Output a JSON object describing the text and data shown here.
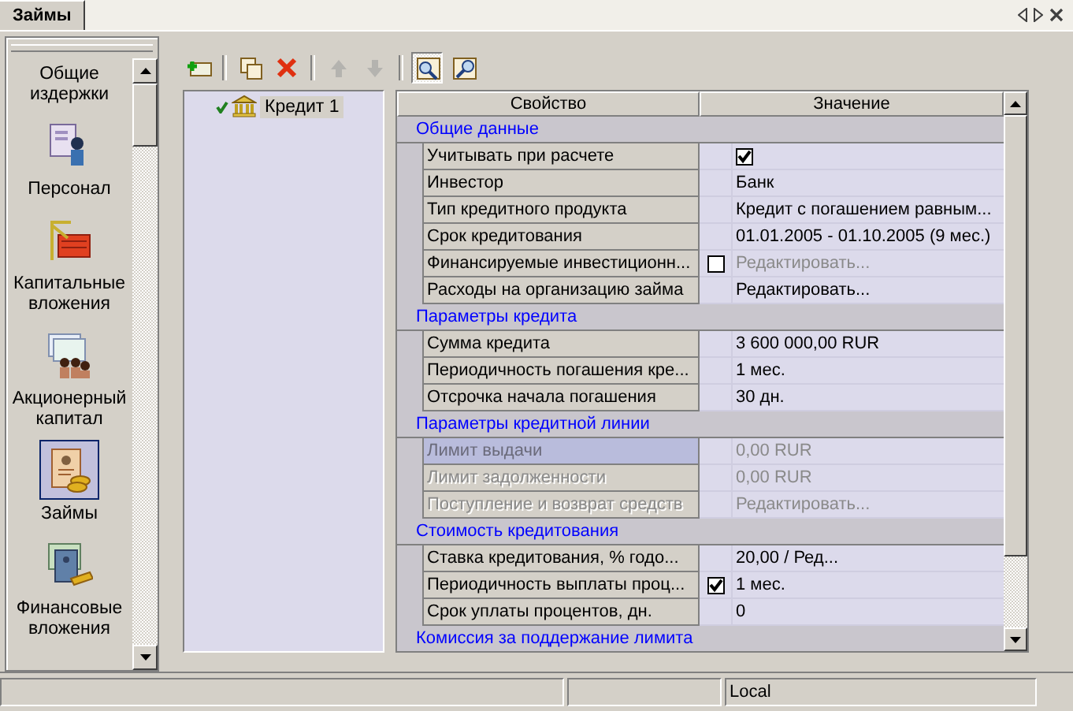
{
  "tabs": [
    {
      "label": "Займы",
      "selected": true
    }
  ],
  "sidebar": {
    "items": [
      {
        "label": "Общие издержки",
        "selected": false
      },
      {
        "label": "Персонал",
        "kind": "staff",
        "selected": false
      },
      {
        "label": "Капитальные вложения",
        "kind": "construction",
        "selected": false
      },
      {
        "label": "Акционерный капитал",
        "kind": "shareholders",
        "selected": false
      },
      {
        "label": "Займы",
        "kind": "loans",
        "selected": true
      },
      {
        "label": "Финансовые вложения",
        "kind": "investments",
        "selected": false
      }
    ]
  },
  "toolbar": {
    "buttons": [
      {
        "kind": "add",
        "disabled": false,
        "pressed": false
      },
      {
        "kind": "copy",
        "disabled": false,
        "pressed": false
      },
      {
        "kind": "delete",
        "disabled": false,
        "pressed": false
      },
      {
        "kind": "up",
        "disabled": true,
        "pressed": false
      },
      {
        "kind": "down",
        "disabled": true,
        "pressed": false
      },
      {
        "kind": "view",
        "disabled": false,
        "pressed": true
      },
      {
        "kind": "find",
        "disabled": false,
        "pressed": false
      }
    ]
  },
  "tree": {
    "items": [
      {
        "label": "Кредит 1",
        "checked": true,
        "selected": true
      }
    ]
  },
  "grid": {
    "columns": [
      "Свойство",
      "Значение"
    ],
    "groups": [
      {
        "title": "Общие данные",
        "rows": [
          {
            "kind": "check",
            "name": "Учитывать при расчете",
            "checked": true,
            "disabled": false,
            "selected": false
          },
          {
            "kind": "text",
            "name": "Инвестор",
            "value": "Банк",
            "disabled": false,
            "selected": false
          },
          {
            "kind": "text",
            "name": "Тип кредитного продукта",
            "value": "Кредит с погашением равным...",
            "disabled": false,
            "selected": false
          },
          {
            "kind": "text",
            "name": "Срок кредитования",
            "value": "01.01.2005 - 01.10.2005 (9 мес.)",
            "disabled": false,
            "selected": false
          },
          {
            "kind": "toggle",
            "name": "Финансируемые инвестиционн...",
            "checked": false,
            "value": "Редактировать...",
            "disabled": false,
            "selected": false
          },
          {
            "kind": "text",
            "name": "Расходы на организацию займа",
            "value": "Редактировать...",
            "disabled": false,
            "selected": false
          }
        ]
      },
      {
        "title": "Параметры кредита",
        "rows": [
          {
            "kind": "text",
            "name": "Сумма кредита",
            "value": "3 600 000,00 RUR",
            "disabled": false,
            "selected": false
          },
          {
            "kind": "text",
            "name": "Периодичность погашения кре...",
            "value": "1 мес.",
            "disabled": false,
            "selected": false
          },
          {
            "kind": "text",
            "name": "Отсрочка начала погашения",
            "value": "30 дн.",
            "disabled": false,
            "selected": false
          }
        ]
      },
      {
        "title": "Параметры кредитной линии",
        "rows": [
          {
            "kind": "text",
            "name": "Лимит выдачи",
            "value": "0,00 RUR",
            "disabled": true,
            "selected": true
          },
          {
            "kind": "text",
            "name": "Лимит задолженности",
            "value": "0,00 RUR",
            "disabled": true,
            "selected": false
          },
          {
            "kind": "text",
            "name": "Поступление и возврат средств",
            "value": "Редактировать...",
            "disabled": true,
            "selected": false
          }
        ]
      },
      {
        "title": "Стоимость кредитования",
        "rows": [
          {
            "kind": "text",
            "name": "Ставка кредитования, % годо...",
            "value": "20,00 / Ред...",
            "disabled": false,
            "selected": false
          },
          {
            "kind": "toggle",
            "name": "Периодичность выплаты проц...",
            "checked": true,
            "value": "1 мес.",
            "disabled": false,
            "selected": false
          },
          {
            "kind": "text",
            "name": "Срок уплаты процентов, дн.",
            "value": "0",
            "disabled": false,
            "selected": false
          }
        ]
      },
      {
        "title": "Комиссия за поддержание лимита"
      }
    ]
  },
  "status_bar": {
    "text": "Local"
  }
}
